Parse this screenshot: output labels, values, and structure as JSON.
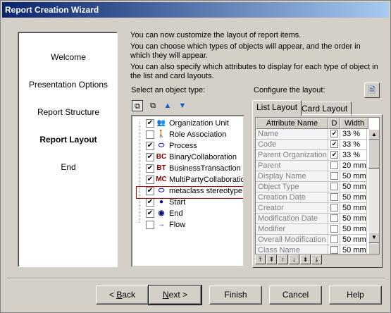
{
  "window": {
    "title": "Report Creation Wizard"
  },
  "steps": [
    {
      "label": "Welcome",
      "active": false
    },
    {
      "label": "Presentation Options",
      "active": false
    },
    {
      "label": "Report Structure",
      "active": false
    },
    {
      "label": "Report Layout",
      "active": true
    },
    {
      "label": "End",
      "active": false
    }
  ],
  "intro": {
    "p1": "You can now customize the layout of report items.",
    "p2": "You can choose which types of objects will appear, and the order in which they will appear.",
    "p3": "You can also specify which attributes to display for each type of object in the list and card layouts."
  },
  "object_type_label": "Select an object type:",
  "configure_label": "Configure the layout:",
  "tree_toolbar": [
    "select-all-icon",
    "deselect-all-icon",
    "move-up-icon",
    "move-down-icon"
  ],
  "tree_items": [
    {
      "label": "Organization Unit",
      "checked": true,
      "icon": "org-unit-icon",
      "glyph": "👥",
      "color": "#e0a000"
    },
    {
      "label": "Role Association",
      "checked": false,
      "icon": "role-association-icon",
      "glyph": "🚶",
      "color": "#0000c0"
    },
    {
      "label": "Process",
      "checked": true,
      "icon": "process-icon",
      "glyph": "⬭",
      "color": "#0000ff"
    },
    {
      "label": "BinaryCollaboration",
      "checked": true,
      "icon": "binary-collaboration-icon",
      "glyph": "BC",
      "color": "#800000"
    },
    {
      "label": "BusinessTransaction",
      "checked": true,
      "icon": "business-transaction-icon",
      "glyph": "BT",
      "color": "#800000"
    },
    {
      "label": "MultiPartyCollaboration",
      "checked": true,
      "icon": "multiparty-collaboration-icon",
      "glyph": "MC",
      "color": "#800000"
    },
    {
      "label": "metaclass stereotype",
      "checked": true,
      "icon": "metaclass-stereotype-icon",
      "glyph": "⬭",
      "color": "#0000ff"
    },
    {
      "label": "Start",
      "checked": true,
      "icon": "start-icon",
      "glyph": "●",
      "color": "#000080"
    },
    {
      "label": "End",
      "checked": true,
      "icon": "end-icon",
      "glyph": "◉",
      "color": "#000080"
    },
    {
      "label": "Flow",
      "checked": false,
      "icon": "flow-icon",
      "glyph": "→",
      "color": "#0000c0"
    }
  ],
  "tabs": [
    {
      "label": "List Layout",
      "active": true
    },
    {
      "label": "Card Layout",
      "active": false
    }
  ],
  "grid": {
    "headers": [
      "Attribute Name",
      "D",
      "Width"
    ],
    "rows": [
      {
        "name": "Name",
        "d": true,
        "width": "33 %"
      },
      {
        "name": "Code",
        "d": true,
        "width": "33 %"
      },
      {
        "name": "Parent Organization",
        "d": true,
        "width": "33 %"
      },
      {
        "name": "Parent",
        "d": false,
        "width": "20 mm"
      },
      {
        "name": "Display Name",
        "d": false,
        "width": "50 mm"
      },
      {
        "name": "Object Type",
        "d": false,
        "width": "50 mm"
      },
      {
        "name": "Creation Date",
        "d": false,
        "width": "50 mm"
      },
      {
        "name": "Creator",
        "d": false,
        "width": "50 mm"
      },
      {
        "name": "Modification Date",
        "d": false,
        "width": "50 mm"
      },
      {
        "name": "Modifier",
        "d": false,
        "width": "50 mm"
      },
      {
        "name": "Overall Modification",
        "d": false,
        "width": "50 mm"
      },
      {
        "name": "Class Name",
        "d": false,
        "width": "50 mm"
      }
    ]
  },
  "buttons": {
    "back_prefix": "< ",
    "back_key": "B",
    "back_rest": "ack",
    "next_key": "N",
    "next_rest": "ext >",
    "finish": "Finish",
    "cancel": "Cancel",
    "help": "Help"
  }
}
